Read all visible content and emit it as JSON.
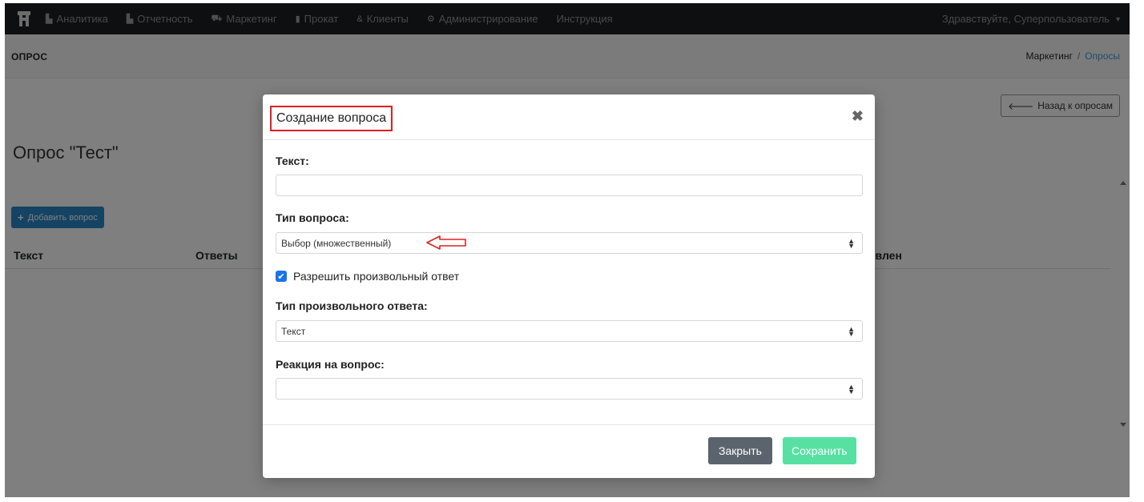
{
  "nav": {
    "items": [
      {
        "label": "Аналитика",
        "icon": "bar-chart-icon"
      },
      {
        "label": "Отчетность",
        "icon": "bar-chart-icon"
      },
      {
        "label": "Маркетинг",
        "icon": "cart-icon"
      },
      {
        "label": "Прокат",
        "icon": "book-icon"
      },
      {
        "label": "Клиенты",
        "icon": "users-icon"
      },
      {
        "label": "Администрирование",
        "icon": "gears-icon"
      },
      {
        "label": "Инструкция",
        "icon": ""
      }
    ],
    "user_greeting": "Здравствуйте, Суперпользователь"
  },
  "page": {
    "header_title": "ОПРОС",
    "breadcrumb": {
      "section": "Маркетинг",
      "separator": "/",
      "current": "Опросы"
    },
    "back_button": "Назад к опросам",
    "survey_title": "Опрос \"Тест\"",
    "add_button": "Добавить вопрос",
    "table_headers": [
      "Текст",
      "Ответы",
      "овлен"
    ]
  },
  "modal": {
    "title": "Создание вопроса",
    "text_label": "Текст:",
    "text_value": "",
    "question_type_label": "Тип вопроса:",
    "question_type_value": "Выбор (множественный)",
    "allow_free_answer_label": "Разрешить произвольный ответ",
    "allow_free_answer_checked": true,
    "free_answer_type_label": "Тип произвольного ответа:",
    "free_answer_type_value": "Текст",
    "reaction_label": "Реакция на вопрос:",
    "reaction_value": "",
    "close_button": "Закрыть",
    "save_button": "Сохранить"
  },
  "colors": {
    "nav_bg": "#1c1f23",
    "primary": "#2a87c9",
    "save_button": "#58e0a3",
    "close_button": "#5b646d",
    "annotation_red": "#e02020",
    "checkbox": "#1a73e8"
  }
}
